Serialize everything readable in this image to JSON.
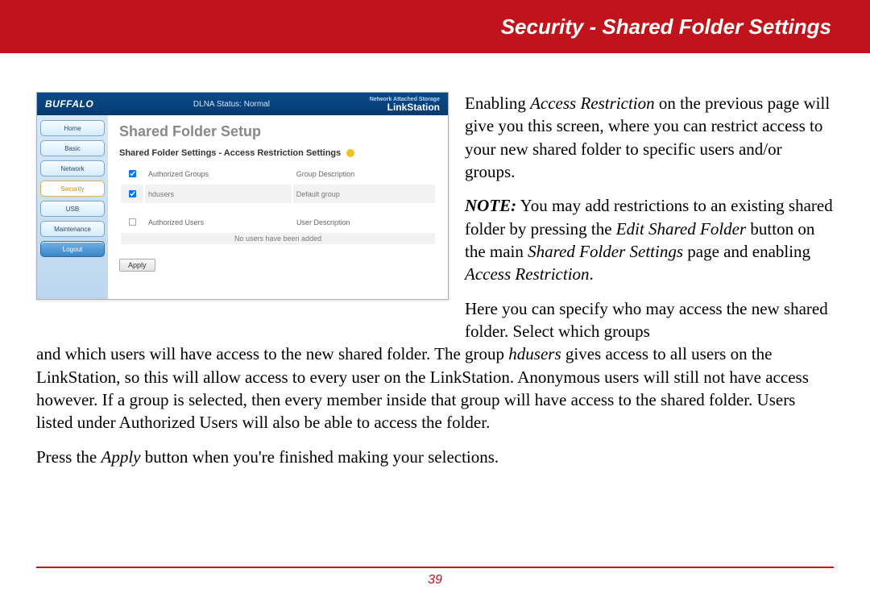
{
  "header": {
    "title": "Security - Shared Folder Settings"
  },
  "screenshot": {
    "brand": "BUFFALO",
    "status": "DLNA Status: Normal",
    "product_small": "Network Attached Storage",
    "product_big": "LinkStation",
    "nav": {
      "home": "Home",
      "basic": "Basic",
      "network": "Network",
      "security": "Security",
      "usb": "USB",
      "maintenance": "Maintenance",
      "logout": "Logout"
    },
    "panel": {
      "h1": "Shared Folder Setup",
      "h2": "Shared Folder Settings - Access Restriction Settings",
      "col_groups": "Authorized Groups",
      "col_group_desc": "Group Description",
      "row_group_name": "hdusers",
      "row_group_desc": "Default group",
      "col_users": "Authorized Users",
      "col_user_desc": "User Description",
      "no_users": "No users have been added",
      "apply": "Apply"
    }
  },
  "para": {
    "p1a": "Enabling ",
    "p1b": "Access Restriction",
    "p1c": " on the previous page will give you this screen, where you can restrict access to your new shared folder to specific users and/or groups.",
    "noteLabel": "NOTE:",
    "p2a": "  You may add restrictions to an existing shared folder by pressing the ",
    "p2b": "Edit Shared Folder",
    "p2c": " button on the main ",
    "p2d": "Shared Folder Settings",
    "p2e": " page and enabling ",
    "p2f": "Access Restriction",
    "p2g": ".",
    "p3a": "Here you can specify who may access the new shared folder.  Select which groups and which users will have access to the new shared folder.  The group ",
    "p3b": "hdusers",
    "p3c": " gives access to all users on the LinkStation, so this will allow access to every user on the LinkStation.  Anonymous users will still not have access however.  If a group is selected, then every member inside that group will have access to the shared folder.  Users listed under Authorized Users will also be able to access the folder.",
    "p4a": "Press the ",
    "p4b": "Apply",
    "p4c": " button when you're finished making your selections."
  },
  "page_number": "39"
}
